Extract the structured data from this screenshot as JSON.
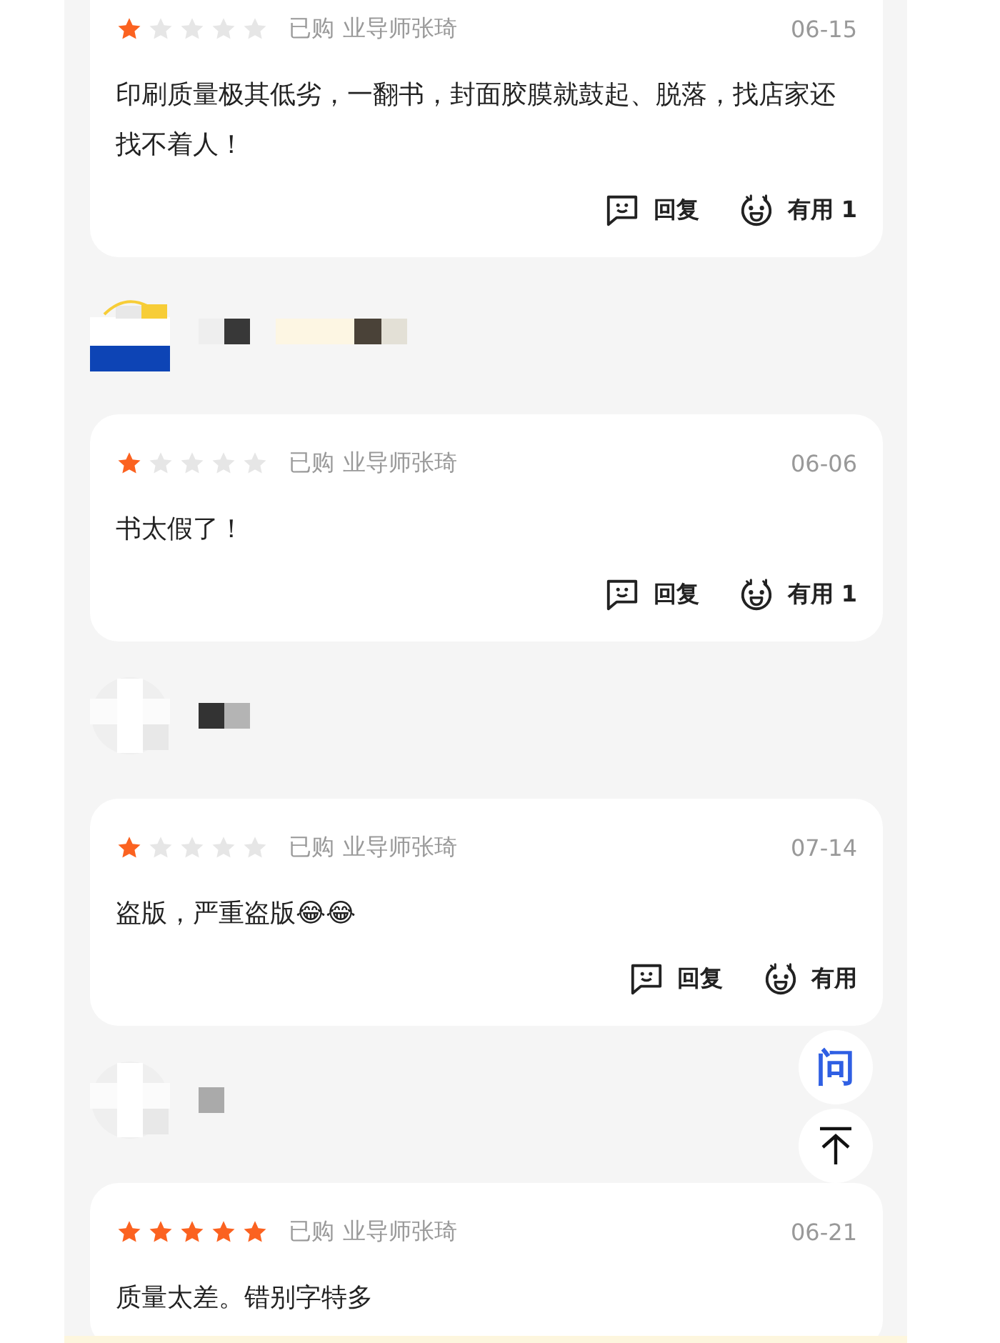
{
  "feed": [
    {
      "kind": "review",
      "stars": 1,
      "purchase": "已购",
      "option": "业导师张琦",
      "date": "06-15",
      "text": "印刷质量极其低劣，一翻书，封面胶膜就鼓起、脱落，找店家还找不着人！",
      "reply": "回复",
      "useful": "有用",
      "useful_count": "1"
    },
    {
      "kind": "user"
    },
    {
      "kind": "review",
      "stars": 1,
      "purchase": "已购",
      "option": "业导师张琦",
      "date": "06-06",
      "text": "书太假了！",
      "reply": "回复",
      "useful": "有用",
      "useful_count": "1"
    },
    {
      "kind": "user"
    },
    {
      "kind": "review",
      "stars": 1,
      "purchase": "已购",
      "option": "业导师张琦",
      "date": "07-14",
      "text": "盗版，严重盗版😂😂",
      "reply": "回复",
      "useful": "有用"
    },
    {
      "kind": "user"
    },
    {
      "kind": "review",
      "stars": 5,
      "purchase": "已购",
      "option": "业导师张琦",
      "date": "06-21",
      "text": "质量太差。错别字特多"
    }
  ],
  "floating": {
    "ask": "问"
  }
}
